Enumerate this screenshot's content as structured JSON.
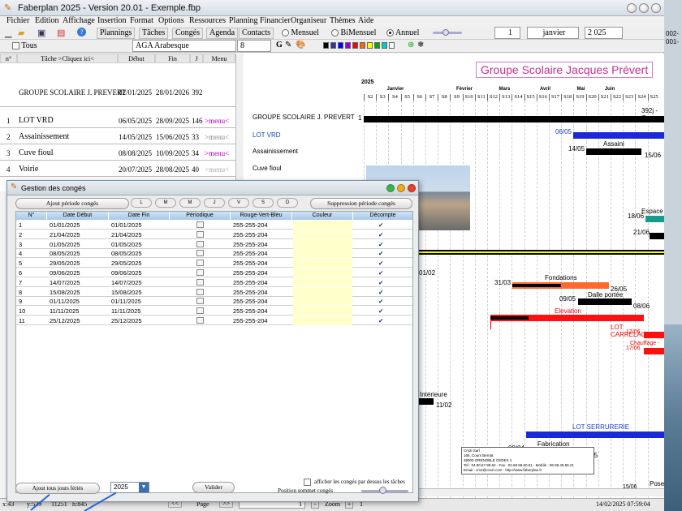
{
  "window": {
    "title": "Faberplan 2025 - Version 20.01 - Exemple.fbp"
  },
  "menu": [
    "Fichier",
    "Edition",
    "Affichage",
    "Insertion",
    "Format",
    "Options",
    "Ressources",
    "Planning Financier",
    "Organiseur",
    "Thèmes",
    "Aide"
  ],
  "toolbar": {
    "tabs": [
      "Plannings",
      "Tâches",
      "Congés",
      "Agenda",
      "Contacts"
    ],
    "views": [
      "Mensuel",
      "BiMensuel",
      "Annuel"
    ],
    "selected_view": "Annuel",
    "page_value": "1",
    "month_value": "janvier",
    "year_value": "2 025",
    "tous_label": "Tous",
    "font_name": "AGA Arabesque",
    "font_size": "8",
    "bold": "G",
    "palette": [
      "#000000",
      "#333399",
      "#0000ff",
      "#9900cc",
      "#ff0000",
      "#ff6600",
      "#ffff00",
      "#00aa00",
      "#00cccc",
      "#ffffff"
    ]
  },
  "task_grid": {
    "headers": [
      "n°",
      "Tâche  >Cliquez ici<",
      "Début",
      "Fin",
      "J",
      "Menu"
    ],
    "group": {
      "name": "GROUPE SCOLAIRE J. PREVERT",
      "start": "02/01/2025",
      "end": "28/01/2026",
      "days": "392"
    },
    "rows": [
      {
        "n": "1",
        "name": "LOT VRD",
        "start": "06/05/2025",
        "end": "28/09/2025",
        "days": "146",
        "menu": ">menu<"
      },
      {
        "n": "2",
        "name": "Assainissement",
        "start": "14/05/2025",
        "end": "15/06/2025",
        "days": "33",
        "menu": ">menu<"
      },
      {
        "n": "3",
        "name": "Cuve fioul",
        "start": "08/08/2025",
        "end": "10/09/2025",
        "days": "34",
        "menu": ">menu<"
      },
      {
        "n": "4",
        "name": "Voirie",
        "start": "20/07/2025",
        "end": "28/08/2025",
        "days": "40",
        "menu": ">menu<"
      }
    ]
  },
  "gantt": {
    "title": "Groupe Scolaire Jacques Prévert",
    "year": "2025",
    "months": [
      "Janvier",
      "Février",
      "Mars",
      "Avril",
      "Mai",
      "Juin"
    ],
    "weeks": [
      "S2",
      "S3",
      "S4",
      "S5",
      "S6",
      "S7",
      "S8",
      "S9",
      "S10",
      "S11",
      "S12",
      "S13",
      "S14",
      "S15",
      "S16",
      "S17",
      "S18",
      "S19",
      "S20",
      "S21",
      "S22",
      "S23",
      "S24",
      "S25"
    ],
    "labels": [
      "GROUPE SCOLAIRE J. PREVERT",
      "LOT VRD",
      "Assainissement",
      "Cuve fioul"
    ],
    "bar_texts": [
      "1",
      "392j - G",
      "06/05",
      "Assaini",
      "14/05",
      "15/06",
      "Espace",
      "18/06",
      "21/06",
      "01/02",
      "Fondations",
      "31/03",
      "26/05",
      "Dalle portée",
      "09/05",
      "08/06",
      "Elevation",
      "LOT CARRELAGE",
      "17/06",
      "Chauffage -",
      "17/06",
      "Intérieure",
      "11/02",
      "LOT SERRURERIE",
      "Fabrication",
      "08/04",
      "09/05",
      "15/06",
      "Pose"
    ],
    "company": [
      "Cm2i Sarl",
      "166, Cours Berriat",
      "38000 GRENOBLE CEDEX 1",
      "Tel : 04.80.67.98.62 - Fax : 04.69.96.60.61 - Mobile : 06.09.45.59.21",
      "Email : cm2@cm2i.com - http://www.faberplan.fr"
    ]
  },
  "status": {
    "x": "x:43",
    "y": "y:539",
    "a": "11251",
    "h": "h:845",
    "nav_prev": "<<",
    "page": "Page",
    "nav_next": ">>",
    "page_num": "1",
    "zoom": "Zoom",
    "zoom_plus": "+",
    "zoom_val": "1",
    "datetime": "14/02/2025 07:59:04"
  },
  "dialog": {
    "title": "Gestion des congés",
    "add_period": "Ajout période congés",
    "delete_period": "Suppression période congés",
    "days": [
      "L",
      "M",
      "M",
      "J",
      "V",
      "S",
      "D"
    ],
    "columns": [
      "N°",
      "Date Début",
      "Date Fin",
      "Périodique",
      "Rouge-Vert-Bleu",
      "Couleur",
      "Décompte"
    ],
    "rows": [
      {
        "n": "1",
        "start": "01/01/2025",
        "end": "01/01/2025",
        "rgb": "255-255-204"
      },
      {
        "n": "2",
        "start": "21/04/2025",
        "end": "21/04/2025",
        "rgb": "255-255-204"
      },
      {
        "n": "3",
        "start": "01/05/2025",
        "end": "01/05/2025",
        "rgb": "255-255-204"
      },
      {
        "n": "4",
        "start": "08/05/2025",
        "end": "08/05/2025",
        "rgb": "255-255-204"
      },
      {
        "n": "5",
        "start": "29/05/2025",
        "end": "29/05/2025",
        "rgb": "255-255-204"
      },
      {
        "n": "6",
        "start": "09/06/2025",
        "end": "09/06/2025",
        "rgb": "255-255-204"
      },
      {
        "n": "7",
        "start": "14/07/2025",
        "end": "14/07/2025",
        "rgb": "255-255-204"
      },
      {
        "n": "8",
        "start": "15/08/2025",
        "end": "15/08/2025",
        "rgb": "255-255-204"
      },
      {
        "n": "9",
        "start": "01/11/2025",
        "end": "01/11/2025",
        "rgb": "255-255-204"
      },
      {
        "n": "10",
        "start": "11/11/2025",
        "end": "11/11/2025",
        "rgb": "255-255-204"
      },
      {
        "n": "11",
        "start": "25/12/2025",
        "end": "25/12/2025",
        "rgb": "255-255-204"
      }
    ],
    "color_cell": "#ffffcc",
    "add_holidays": "Ajout tous jours fériés",
    "year_value": "2025",
    "validate": "Valider",
    "show_above": "afficher les congés par dessus les tâches",
    "position_label": "Position sommet congés"
  },
  "side": {
    "l1": "002-",
    "l2": "001-"
  }
}
